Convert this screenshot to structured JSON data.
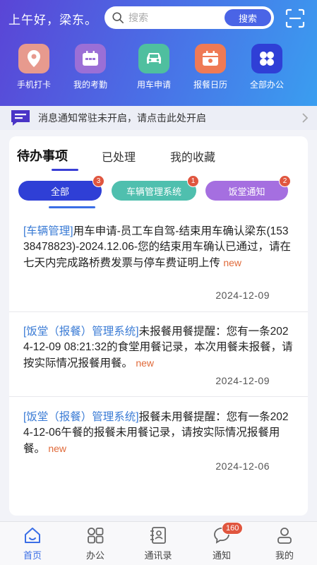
{
  "header": {
    "greeting": "上午好，梁东。",
    "search_placeholder": "搜索",
    "search_button": "搜索"
  },
  "quick_actions": [
    {
      "label": "手机打卡",
      "icon": "location-pin-icon",
      "color": "#e79a8e"
    },
    {
      "label": "我的考勤",
      "icon": "calendar-icon",
      "color": "#9b6fd6"
    },
    {
      "label": "用车申请",
      "icon": "car-icon",
      "color": "#4fbf9f"
    },
    {
      "label": "报餐日历",
      "icon": "meal-calendar-icon",
      "color": "#ef7a55"
    },
    {
      "label": "全部办公",
      "icon": "grid-icon",
      "color": "#2f3fd6"
    }
  ],
  "notice": {
    "text": "消息通知常驻未开启，请点击此处开启"
  },
  "tabs": [
    "待办事项",
    "已处理",
    "我的收藏"
  ],
  "filters": [
    {
      "label": "全部",
      "count": "3",
      "color": "#2f3fd6"
    },
    {
      "label": "车辆管理系统",
      "count": "1",
      "color": "#4fbfae"
    },
    {
      "label": "饭堂通知",
      "count": "2",
      "color": "#a56fe0"
    }
  ],
  "items": [
    {
      "tag": "[车辆管理]",
      "text": "用车申请-员工车自驾-结束用车确认梁东(15338478823)-2024.12.06-您的结束用车确认已通过，请在七天内完成路桥费发票与停车费证明上传",
      "new_label": "new",
      "date": "2024-12-09"
    },
    {
      "tag": "[饭堂（报餐）管理系统]",
      "text": "未报餐用餐提醒：您有一条2024-12-09 08:21:32的食堂用餐记录，本次用餐未报餐，请按实际情况报餐用餐。",
      "new_label": "new",
      "date": "2024-12-09"
    },
    {
      "tag": "[饭堂（报餐）管理系统]",
      "text": "报餐未用餐提醒：您有一条2024-12-06午餐的报餐未用餐记录，请按实际情况报餐用餐。",
      "new_label": "new",
      "date": "2024-12-06"
    }
  ],
  "bottom_nav": [
    {
      "label": "首页",
      "icon": "home-icon"
    },
    {
      "label": "办公",
      "icon": "apps-icon"
    },
    {
      "label": "通讯录",
      "icon": "contacts-icon"
    },
    {
      "label": "通知",
      "icon": "chat-bubble-icon",
      "badge": "160"
    },
    {
      "label": "我的",
      "icon": "user-icon"
    }
  ]
}
